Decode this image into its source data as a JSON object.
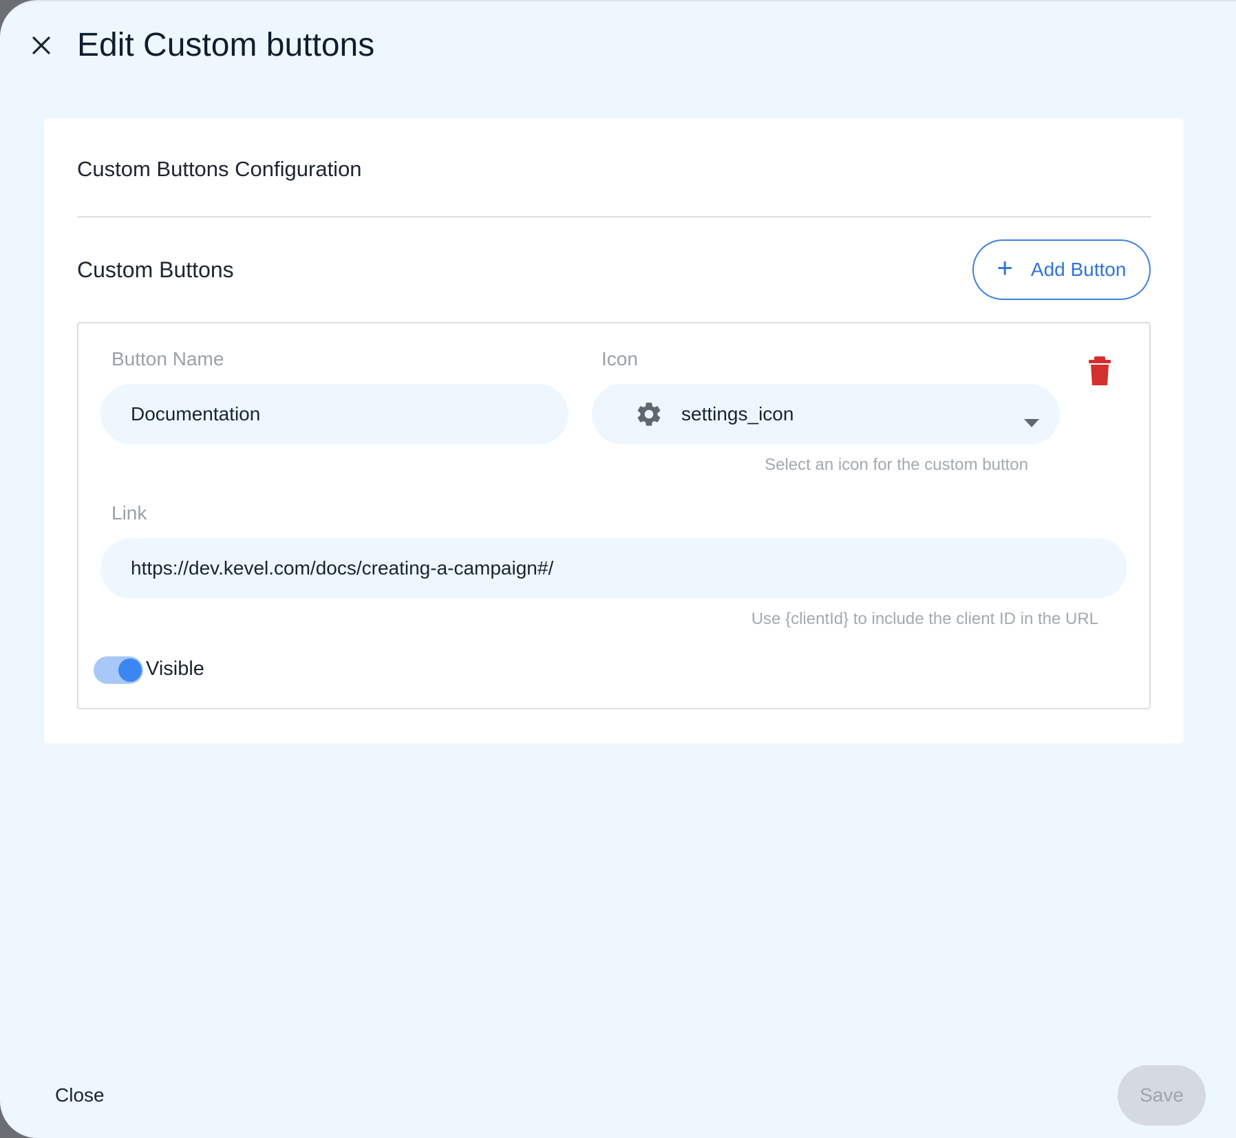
{
  "dialog": {
    "title": "Edit Custom buttons",
    "close_label": "Close",
    "save_label": "Save"
  },
  "config": {
    "section_title": "Custom Buttons Configuration",
    "subsection_title": "Custom Buttons",
    "add_button_label": "Add Button"
  },
  "buttons": [
    {
      "name_label": "Button Name",
      "name_value": "Documentation",
      "icon_label": "Icon",
      "icon_value": "settings_icon",
      "icon_helper": "Select an icon for the custom button",
      "link_label": "Link",
      "link_value": "https://dev.kevel.com/docs/creating-a-campaign#/",
      "link_helper": "Use {clientId} to include the client ID in the URL",
      "visible_label": "Visible",
      "visible": true
    }
  ],
  "icons": {
    "close": "close-icon",
    "plus": "plus-icon",
    "trash": "trash-icon",
    "gear": "gear-icon",
    "dropdown": "chevron-down-icon"
  },
  "colors": {
    "accent": "#3d7fe0",
    "delete": "#d32f2f",
    "background": "#eef7fe",
    "toggle_track": "#a8c8f8",
    "toggle_knob": "#3b86f0"
  }
}
